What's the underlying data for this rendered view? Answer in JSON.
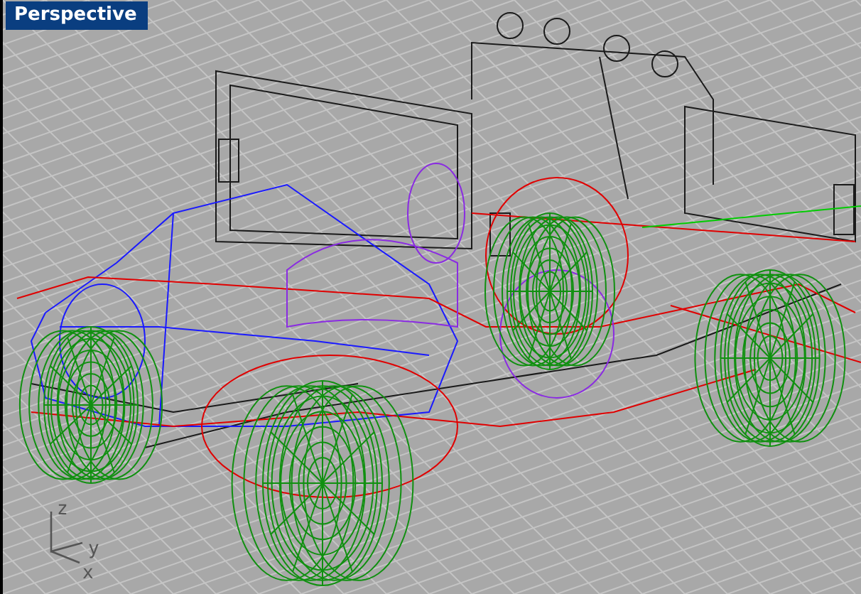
{
  "viewport": {
    "title": "Perspective"
  },
  "axis_labels": [
    "z",
    "y",
    "x"
  ]
}
